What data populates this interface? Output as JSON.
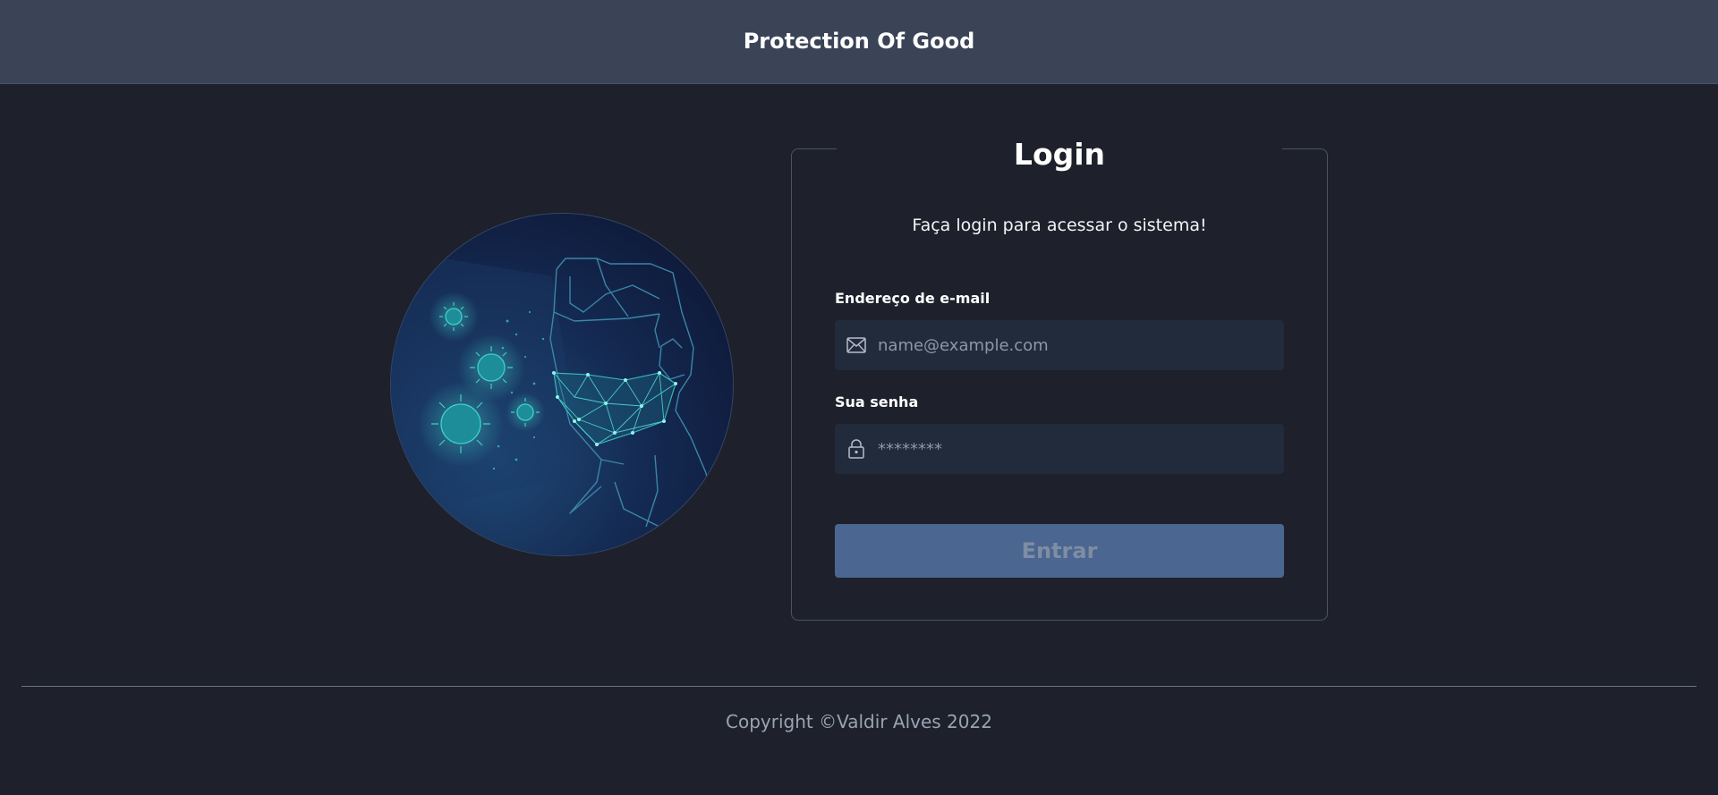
{
  "header": {
    "title": "Protection Of Good"
  },
  "illustration": {
    "icon": "masked-person-virus-illustration"
  },
  "login": {
    "title": "Login",
    "subtitle": "Faça login para acessar o sistema!",
    "email": {
      "label": "Endereço de e-mail",
      "placeholder": "name@example.com",
      "icon": "envelope-icon"
    },
    "password": {
      "label": "Sua senha",
      "placeholder": "********",
      "icon": "lock-icon"
    },
    "submit_label": "Entrar"
  },
  "footer": {
    "copyright": "Copyright ©Valdir Alves 2022"
  },
  "colors": {
    "background": "#1e212b",
    "header": "#3a4456",
    "input": "#222b3b",
    "button": "#4b6690",
    "accent": "#2fb3b0"
  }
}
